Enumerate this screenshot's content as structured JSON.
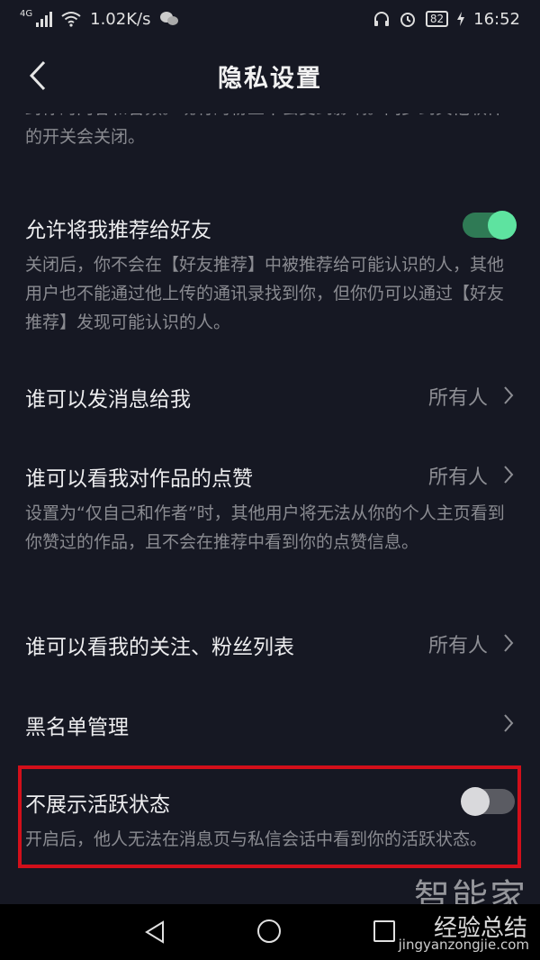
{
  "status_bar": {
    "network": "4G",
    "speed": "1.02K/s",
    "battery": "82",
    "time": "16:52"
  },
  "header": {
    "title": "隐私设置"
  },
  "clipped_description": "封你的内容和音频。现有的粉丝不会受到影响。同步到其他软件的开关会关闭。",
  "rows": [
    {
      "title": "允许将我推荐给好友",
      "description": "关闭后，你不会在【好友推荐】中被推荐给可能认识的人，其他用户也不能通过他上传的通讯录找到你，但你仍可以通过【好友推荐】发现可能认识的人。",
      "toggle": "on"
    },
    {
      "title": "谁可以发消息给我",
      "value": "所有人"
    },
    {
      "title": "谁可以看我对作品的点赞",
      "value": "所有人",
      "description": "设置为“仅自己和作者”时，其他用户将无法从你的个人主页看到你赞过的作品，且不会在推荐中看到你的点赞信息。"
    },
    {
      "title": "谁可以看我的关注、粉丝列表",
      "value": "所有人"
    },
    {
      "title": "黑名单管理"
    },
    {
      "title": "不展示活跃状态",
      "description": "开启后，他人无法在消息页与私信会话中看到你的活跃状态。",
      "toggle": "off"
    }
  ],
  "watermark": {
    "brand": "智能家",
    "site_cn": "经验总结",
    "url": "jingyanzongjie.com"
  },
  "colors": {
    "accent_on": "#5ee3a0",
    "highlight": "#d20f1a",
    "background": "#161823"
  }
}
